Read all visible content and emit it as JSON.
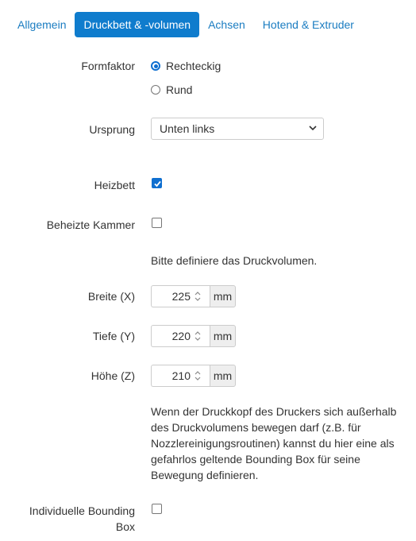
{
  "tabs": [
    {
      "label": "Allgemein",
      "active": false
    },
    {
      "label": "Druckbett & -volumen",
      "active": true
    },
    {
      "label": "Achsen",
      "active": false
    },
    {
      "label": "Hotend & Extruder",
      "active": false
    }
  ],
  "form_factor": {
    "label": "Formfaktor",
    "options": [
      "Rechteckig",
      "Rund"
    ],
    "selected": "Rechteckig"
  },
  "origin": {
    "label": "Ursprung",
    "value": "Unten links"
  },
  "heated_bed": {
    "label": "Heizbett",
    "checked": true
  },
  "heated_chamber": {
    "label": "Beheizte Kammer",
    "checked": false
  },
  "volume_hint": "Bitte definiere das Druckvolumen.",
  "dimensions": [
    {
      "label": "Breite (X)",
      "value": "225",
      "unit": "mm"
    },
    {
      "label": "Tiefe (Y)",
      "value": "220",
      "unit": "mm"
    },
    {
      "label": "Höhe (Z)",
      "value": "210",
      "unit": "mm"
    }
  ],
  "bounding_box_help": [
    "Wenn der Druckkopf des Druckers sich außerhalb",
    "des Druckvolumens bewegen darf (z.B. für",
    "Nozzlereinigungsroutinen) kannst du hier eine als",
    "gefahrlos geltende Bounding Box für seine",
    "Bewegung definieren."
  ],
  "custom_bounding_box": {
    "label_lines": [
      "Individuelle Bounding",
      "Box"
    ],
    "checked": false
  },
  "colors": {
    "accent": "#0f7ccd",
    "link": "#1a7cc1",
    "text": "#333333"
  }
}
